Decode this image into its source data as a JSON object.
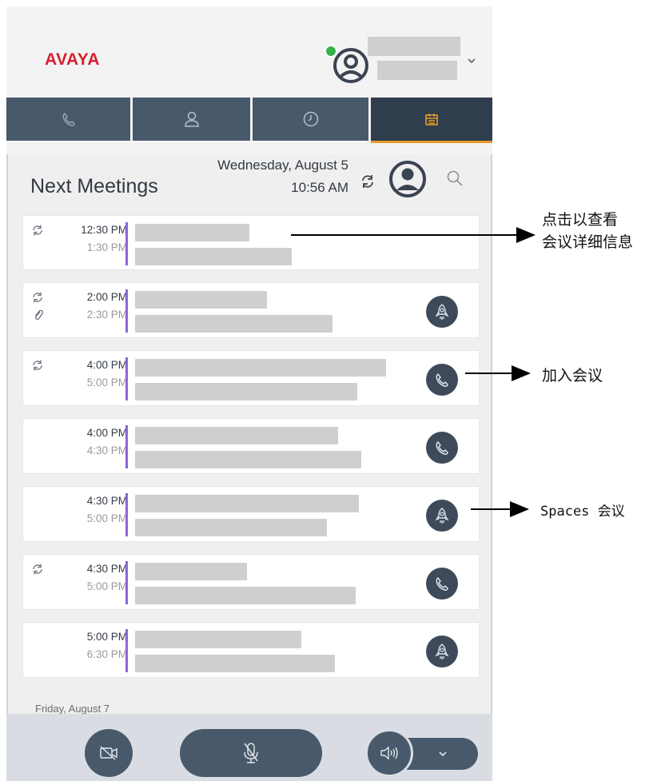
{
  "app": {
    "logo": "AVAYA"
  },
  "tabs": [
    {
      "name": "calls",
      "icon": "phone-icon"
    },
    {
      "name": "contacts",
      "icon": "contact-icon"
    },
    {
      "name": "history",
      "icon": "clock-icon"
    },
    {
      "name": "calendar",
      "icon": "calendar-icon",
      "active": true
    }
  ],
  "panel": {
    "title": "Next Meetings",
    "date": "Wednesday, August 5",
    "time": "10:56 AM"
  },
  "meetings": [
    {
      "start": "12:30 PM",
      "end": "1:30 PM",
      "recurring": true,
      "attachment": false,
      "action": "none"
    },
    {
      "start": "2:00 PM",
      "end": "2:30 PM",
      "recurring": true,
      "attachment": true,
      "action": "spaces-icon"
    },
    {
      "start": "4:00 PM",
      "end": "5:00 PM",
      "recurring": true,
      "attachment": false,
      "action": "phone-icon"
    },
    {
      "start": "4:00 PM",
      "end": "4:30 PM",
      "recurring": false,
      "attachment": false,
      "action": "phone-icon"
    },
    {
      "start": "4:30 PM",
      "end": "5:00 PM",
      "recurring": false,
      "attachment": false,
      "action": "spaces-icon"
    },
    {
      "start": "4:30 PM",
      "end": "5:00 PM",
      "recurring": true,
      "attachment": false,
      "action": "phone-icon"
    },
    {
      "start": "5:00 PM",
      "end": "6:30 PM",
      "recurring": false,
      "attachment": false,
      "action": "spaces-icon"
    }
  ],
  "next_day": "Friday, August 7",
  "callouts": {
    "view_details_line1": "点击以查看",
    "view_details_line2": "会议详细信息",
    "join_meeting": "加入会议",
    "spaces_meeting": "Spaces 会议"
  },
  "colors": {
    "brand_red": "#d6202f",
    "tab_bg": "#48596b",
    "tab_active_bg": "#2f3d4d",
    "tab_active_underline": "#e79a2c",
    "calendar_icon": "#e79a2c",
    "meeting_accent": "#8c66d8",
    "presence_available": "#35b34a"
  }
}
